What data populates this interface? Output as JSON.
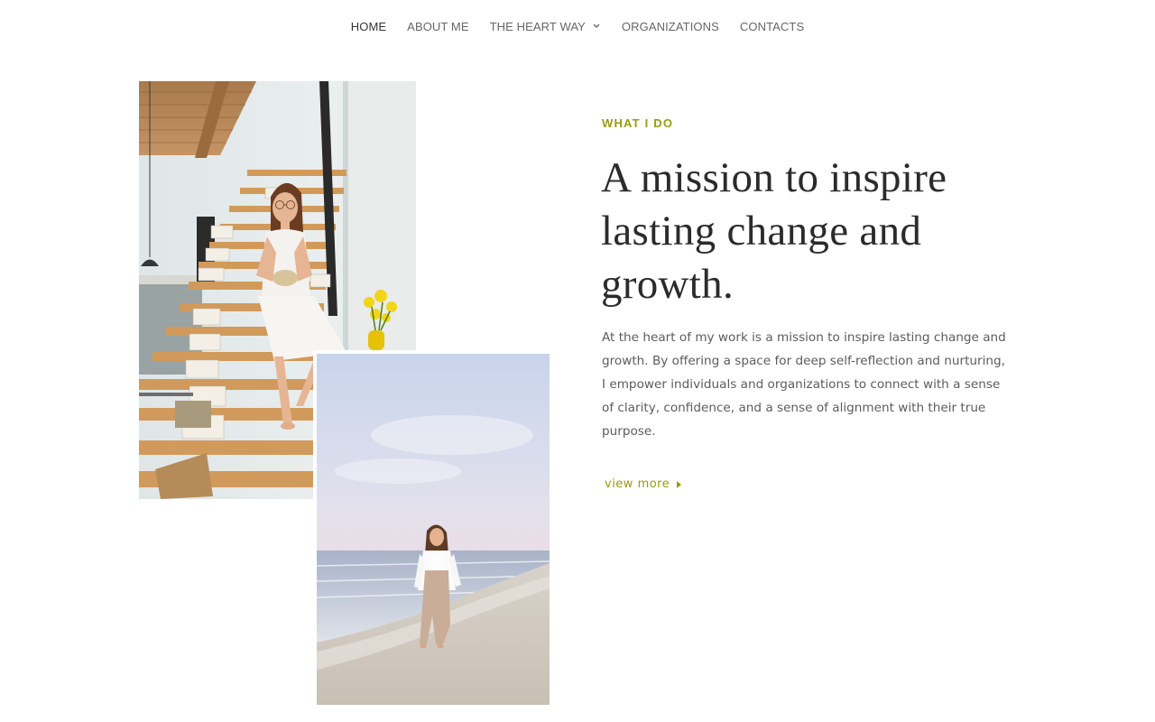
{
  "nav": {
    "items": [
      {
        "label": "HOME",
        "active": true
      },
      {
        "label": "ABOUT ME",
        "active": false
      },
      {
        "label": "THE HEART WAY",
        "active": false,
        "has_dropdown": true
      },
      {
        "label": "ORGANIZATIONS",
        "active": false
      },
      {
        "label": "CONTACTS",
        "active": false
      }
    ]
  },
  "section": {
    "eyebrow": "WHAT I DO",
    "headline": "A mission to inspire lasting change and growth.",
    "body": "At the heart of my work is a mission to inspire lasting change and growth. By offering a space for deep self-reflection and nurturing, I empower individuals and organizations to connect with a sense of clarity, confidence, and a sense of alignment with their true purpose.",
    "link_label": "view more"
  },
  "colors": {
    "accent": "#9a9a12",
    "heading": "#2b2b2b",
    "body": "#5c5c5c",
    "nav": "#666666"
  },
  "icons": {
    "dropdown": "chevron-down-icon",
    "link": "caret-right-icon"
  }
}
